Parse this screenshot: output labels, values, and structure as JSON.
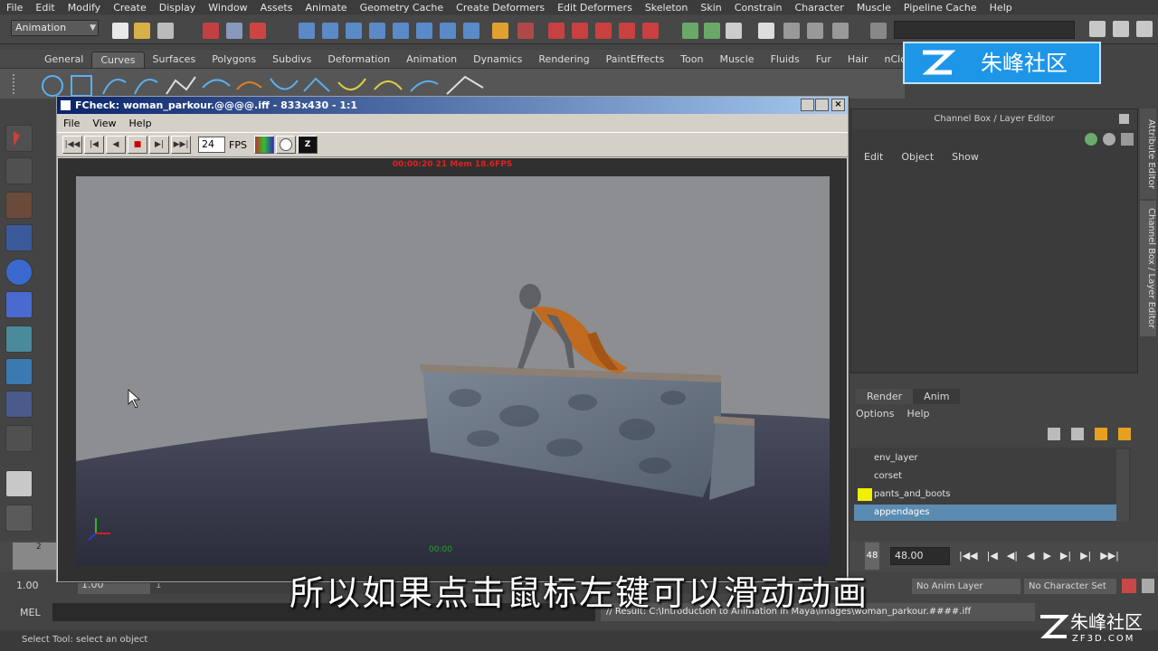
{
  "menubar": [
    "File",
    "Edit",
    "Modify",
    "Create",
    "Display",
    "Window",
    "Assets",
    "Animate",
    "Geometry Cache",
    "Create Deformers",
    "Edit Deformers",
    "Skeleton",
    "Skin",
    "Constrain",
    "Character",
    "Muscle",
    "Pipeline Cache",
    "Help"
  ],
  "statusline": {
    "menuset": "Animation"
  },
  "shelf": {
    "tabs": [
      "General",
      "Curves",
      "Surfaces",
      "Polygons",
      "Subdivs",
      "Deformation",
      "Animation",
      "Dynamics",
      "Rendering",
      "PaintEffects",
      "Toon",
      "Muscle",
      "Fluids",
      "Fur",
      "Hair",
      "nClo"
    ],
    "active": "Curves"
  },
  "fcheck": {
    "title": "FCheck: woman_parkour.@@@@.iff - 833x430 - 1:1",
    "menu": [
      "File",
      "View",
      "Help"
    ],
    "fps_value": "24",
    "fps_label": "FPS",
    "overlay": "00:00:20   21  Mem 18.6FPS",
    "frame_counter": "00:00",
    "buttons": {
      "first": "|◀◀",
      "prev_key": "|◀",
      "back": "◀",
      "stop": "■",
      "next": "▶|",
      "last": "▶▶|"
    }
  },
  "channelbox": {
    "title": "Channel Box / Layer Editor",
    "menu": [
      "Edit",
      "Object",
      "Show"
    ]
  },
  "side_tabs": [
    "Attribute Editor",
    "Channel Box / Layer Editor"
  ],
  "layer_editor": {
    "tabs": [
      "Render",
      "Anim"
    ],
    "menu": [
      "Options",
      "Help"
    ],
    "layers": [
      {
        "name": "env_layer",
        "color": ""
      },
      {
        "name": "corset",
        "color": ""
      },
      {
        "name": "pants_and_boots",
        "color": "#f0f000"
      },
      {
        "name": "appendages",
        "color": "",
        "selected": true
      }
    ]
  },
  "timeline": {
    "current_frame": "48.00",
    "tick_start": "2",
    "end_frame": "48",
    "range_start": "1.00",
    "range_start2": "1.00",
    "range_mark": "1",
    "anim_layer": "No Anim Layer",
    "character_set": "No Character Set"
  },
  "cmdline": {
    "label": "MEL",
    "result": "// Result: C:\\Introduction to Animation in Maya\\images\\woman_parkour.####.iff"
  },
  "helpline": "Select Tool: select an object",
  "subtitle": "所以如果点击鼠标左键可以滑动动画",
  "branding": {
    "top": "朱峰社区",
    "bottom": "朱峰社区",
    "bottom_url": "ZF3D.COM"
  },
  "colors": {
    "title_gradient_start": "#0a246a",
    "selected_layer": "#5b8bb0",
    "brand_blue": "#1e96e8"
  }
}
